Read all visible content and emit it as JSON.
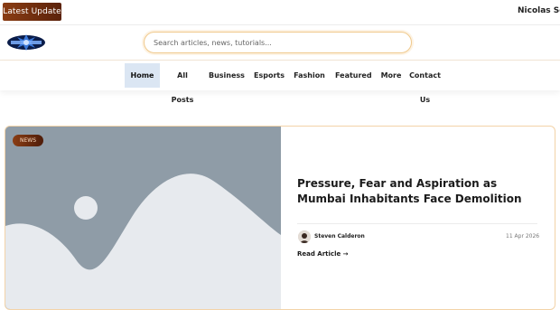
{
  "ticker": {
    "badge_label": "Latest Update",
    "headline": "Nicolas Sc"
  },
  "search": {
    "placeholder": "Search articles, news, tutorials..."
  },
  "nav": {
    "items": [
      {
        "label": "Home",
        "active": true
      },
      {
        "label": "All Posts",
        "active": false
      },
      {
        "label": "Business",
        "active": false
      },
      {
        "label": "Esports",
        "active": false
      },
      {
        "label": "Fashion",
        "active": false
      },
      {
        "label": "Featured",
        "active": false
      },
      {
        "label": "More",
        "active": false
      },
      {
        "label": "Contact Us",
        "active": false
      }
    ]
  },
  "featured": {
    "category": "NEWS",
    "title": "Pressure, Fear and Aspiration as Mumbai Inhabitants Face Demolition",
    "author": "Steven Calderon",
    "date": "11 Apr 2026",
    "read_more": "Read Article →",
    "image_icon": "image-placeholder-icon"
  },
  "colors": {
    "accent_brown": "#7a3210",
    "search_border": "#f0c98c",
    "active_nav_bg": "#dbe6f3",
    "card_border": "#f3d3a8"
  }
}
